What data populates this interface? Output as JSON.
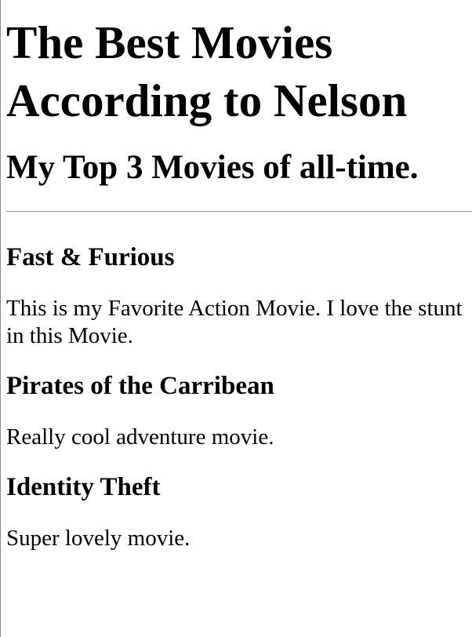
{
  "page": {
    "title": "The Best Movies According to Nelson",
    "subtitle": "My Top 3 Movies of all-time."
  },
  "movies": [
    {
      "title": "Fast & Furious",
      "description": "This is my Favorite Action Movie. I love the stunt in this Movie."
    },
    {
      "title": "Pirates of the Carribean",
      "description": "Really cool adventure movie."
    },
    {
      "title": "Identity Theft",
      "description": "Super lovely movie."
    }
  ]
}
